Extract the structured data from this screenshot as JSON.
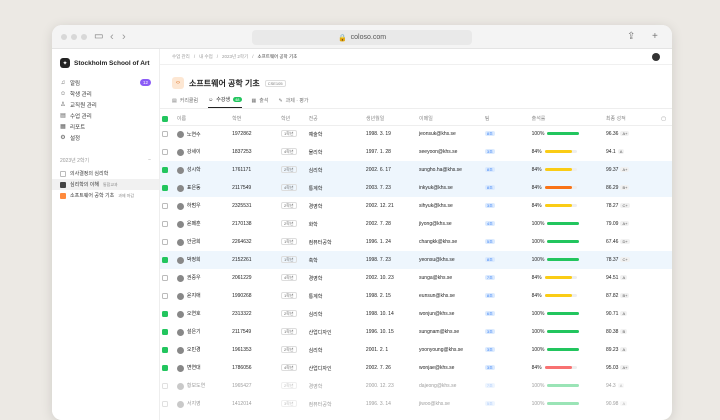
{
  "browser": {
    "url": "coloso.com",
    "colors": {
      "accent": "#22c55e",
      "purple": "#8b5cf6"
    }
  },
  "sidebar": {
    "brand": "Stockholm School of Art",
    "items": [
      {
        "icon": "bell-icon",
        "label": "알림",
        "badge": "12"
      },
      {
        "icon": "users-icon",
        "label": "학생 관리"
      },
      {
        "icon": "teacher-icon",
        "label": "교직원 관리"
      },
      {
        "icon": "class-icon",
        "label": "수업 관리"
      },
      {
        "icon": "report-icon",
        "label": "리포트"
      },
      {
        "icon": "gear-icon",
        "label": "설정"
      }
    ],
    "group_label": "2023년 2학기",
    "courses": [
      {
        "label": "의사결정의 심리학",
        "tag": "",
        "style": ""
      },
      {
        "label": "심리학의 이해",
        "tag": "통합교과",
        "style": "dark"
      },
      {
        "label": "소프트웨어 공학 기초",
        "tag": "과제 마감",
        "style": "orange"
      }
    ]
  },
  "breadcrumb": [
    "수업 관리",
    "내 수업",
    "2023년 2학기",
    "소프트웨어 공학 기초"
  ],
  "course": {
    "title": "소프트웨어 공학 기초",
    "code": "CSE105"
  },
  "tabs": [
    {
      "label": "커리큘럼"
    },
    {
      "label": "수강생",
      "count": "48",
      "active": true
    },
    {
      "label": "출석"
    },
    {
      "label": "과제 · 평가"
    }
  ],
  "table": {
    "headers": [
      "이름",
      "학번",
      "학년",
      "전공",
      "생년월일",
      "이메일",
      "팀",
      "출석률",
      "최종 성적"
    ],
    "rows": [
      {
        "name": "노연수",
        "id": "1972862",
        "year": "1학년",
        "major": "예술학",
        "birth": "1998. 3. 19",
        "email": "jeonsuk@khs.se",
        "team": "8조",
        "att": "100%",
        "attv": 100,
        "col": "#22c55e",
        "score": "96.36",
        "grade": "A+",
        "checked": false,
        "sel": false
      },
      {
        "name": "강세이",
        "id": "1837253",
        "year": "4학년",
        "major": "물리학",
        "birth": "1997. 1. 28",
        "email": "seeyoon@khs.se",
        "team": "3조",
        "att": "84%",
        "attv": 84,
        "col": "#facc15",
        "score": "94.1",
        "grade": "A",
        "checked": false,
        "sel": false
      },
      {
        "name": "성시학",
        "id": "1761171",
        "year": "2학년",
        "major": "심리학",
        "birth": "2002. 6. 17",
        "email": "sungho.ha@khs.se",
        "team": "8조",
        "att": "84%",
        "attv": 84,
        "col": "#facc15",
        "score": "99.37",
        "grade": "A+",
        "checked": true,
        "sel": true
      },
      {
        "name": "표은동",
        "id": "2117549",
        "year": "4학년",
        "major": "통계학",
        "birth": "2003. 7. 23",
        "email": "inkyuk@khs.se",
        "team": "8조",
        "att": "84%",
        "attv": 84,
        "col": "#f97316",
        "score": "86.29",
        "grade": "B+",
        "checked": true,
        "sel": true
      },
      {
        "name": "하범우",
        "id": "2325531",
        "year": "2학년",
        "major": "경영학",
        "birth": "2002. 12. 21",
        "email": "sihyuk@khs.se",
        "team": "3조",
        "att": "84%",
        "attv": 84,
        "col": "#facc15",
        "score": "78.27",
        "grade": "C+",
        "checked": false,
        "sel": false
      },
      {
        "name": "윤페훈",
        "id": "2170138",
        "year": "2학년",
        "major": "화학",
        "birth": "2002. 7. 28",
        "email": "jiyong@khs.se",
        "team": "4조",
        "att": "100%",
        "attv": 100,
        "col": "#22c55e",
        "score": "79.09",
        "grade": "A+",
        "checked": false,
        "sel": false
      },
      {
        "name": "안금희",
        "id": "2264632",
        "year": "1학년",
        "major": "컴퓨터공학",
        "birth": "1996. 1. 24",
        "email": "changkk@khs.se",
        "team": "5조",
        "att": "100%",
        "attv": 100,
        "col": "#22c55e",
        "score": "67.46",
        "grade": "D+",
        "checked": false,
        "sel": false
      },
      {
        "name": "박정희",
        "id": "2152261",
        "year": "1학년",
        "major": "축학",
        "birth": "1998. 7. 23",
        "email": "yeonsu@khs.se",
        "team": "8조",
        "att": "100%",
        "attv": 100,
        "col": "#22c55e",
        "score": "78.37",
        "grade": "C+",
        "checked": true,
        "sel": true
      },
      {
        "name": "권중우",
        "id": "2061229",
        "year": "4학년",
        "major": "경영학",
        "birth": "2002. 10. 23",
        "email": "sunga@khs.se",
        "team": "7조",
        "att": "84%",
        "attv": 84,
        "col": "#facc15",
        "score": "94.51",
        "grade": "A",
        "checked": false,
        "sel": false
      },
      {
        "name": "윤지애",
        "id": "1990268",
        "year": "1학년",
        "major": "통계학",
        "birth": "1998. 2. 15",
        "email": "eunsun@khs.se",
        "team": "8조",
        "att": "84%",
        "attv": 84,
        "col": "#facc15",
        "score": "87.82",
        "grade": "B+",
        "checked": false,
        "sel": false
      },
      {
        "name": "오연호",
        "id": "2313322",
        "year": "2학년",
        "major": "심리학",
        "birth": "1998. 10. 14",
        "email": "wonjun@khs.se",
        "team": "6조",
        "att": "100%",
        "attv": 100,
        "col": "#22c55e",
        "score": "90.71",
        "grade": "A",
        "checked": true,
        "sel": false
      },
      {
        "name": "설은기",
        "id": "2117549",
        "year": "1학년",
        "major": "산업디자인",
        "birth": "1996. 10. 15",
        "email": "sungnam@khs.se",
        "team": "3조",
        "att": "100%",
        "attv": 100,
        "col": "#22c55e",
        "score": "80.38",
        "grade": "B",
        "checked": true,
        "sel": false
      },
      {
        "name": "오민경",
        "id": "1961353",
        "year": "2학년",
        "major": "심리학",
        "birth": "2001. 2. 1",
        "email": "yoonyoung@khs.se",
        "team": "3조",
        "att": "100%",
        "attv": 100,
        "col": "#22c55e",
        "score": "89.23",
        "grade": "A",
        "checked": true,
        "sel": false
      },
      {
        "name": "변연대",
        "id": "1786056",
        "year": "4학년",
        "major": "산업디자인",
        "birth": "2002. 7. 26",
        "email": "wonjae@khs.se",
        "team": "3조",
        "att": "84%",
        "attv": 84,
        "col": "#f87171",
        "score": "95.03",
        "grade": "A+",
        "checked": true,
        "sel": false
      },
      {
        "name": "황보도연",
        "id": "1965427",
        "year": "2학년",
        "major": "경영학",
        "birth": "2000. 12. 23",
        "email": "dajeong@khs.se",
        "team": "7조",
        "att": "100%",
        "attv": 100,
        "col": "#22c55e",
        "score": "94.3",
        "grade": "A",
        "checked": false,
        "sel": false,
        "faded": true
      },
      {
        "name": "서지영",
        "id": "1412014",
        "year": "3학년",
        "major": "컴퓨터공학",
        "birth": "1996. 3. 14",
        "email": "jiwoo@khs.se",
        "team": "5조",
        "att": "100%",
        "attv": 100,
        "col": "#22c55e",
        "score": "90.98",
        "grade": "A",
        "checked": false,
        "sel": false,
        "faded": true
      }
    ]
  }
}
